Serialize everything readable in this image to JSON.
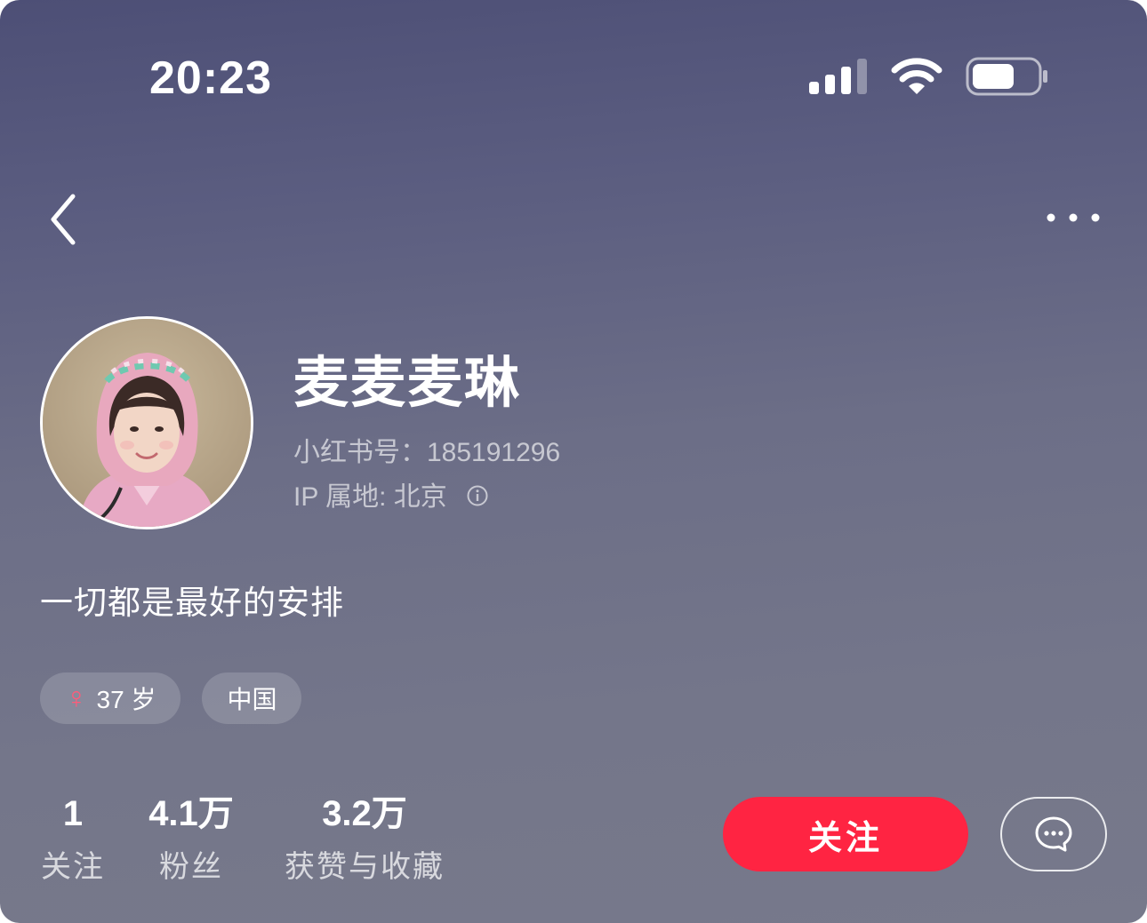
{
  "status_bar": {
    "time": "20:23",
    "icons": [
      "cellular-signal-icon",
      "wifi-icon",
      "battery-icon"
    ]
  },
  "nav": {
    "back_icon": "chevron-left-icon",
    "more_icon": "more-dots-icon"
  },
  "profile": {
    "name": "麦麦麦琳",
    "id_text": "小红书号：185191296",
    "ip_text": "IP 属地: 北京",
    "bio": "一切都是最好的安排",
    "tags": {
      "age": "37 岁",
      "gender_symbol": "♀",
      "region": "中国"
    }
  },
  "stats": [
    {
      "value": "1",
      "label": "关注"
    },
    {
      "value": "4.1万",
      "label": "粉丝"
    },
    {
      "value": "3.2万",
      "label": "获赞与收藏"
    }
  ],
  "actions": {
    "follow_label": "关注",
    "chat_icon": "chat-bubble-icon"
  },
  "colors": {
    "accent": "#ff2442",
    "female_symbol": "#ff5b7a"
  }
}
